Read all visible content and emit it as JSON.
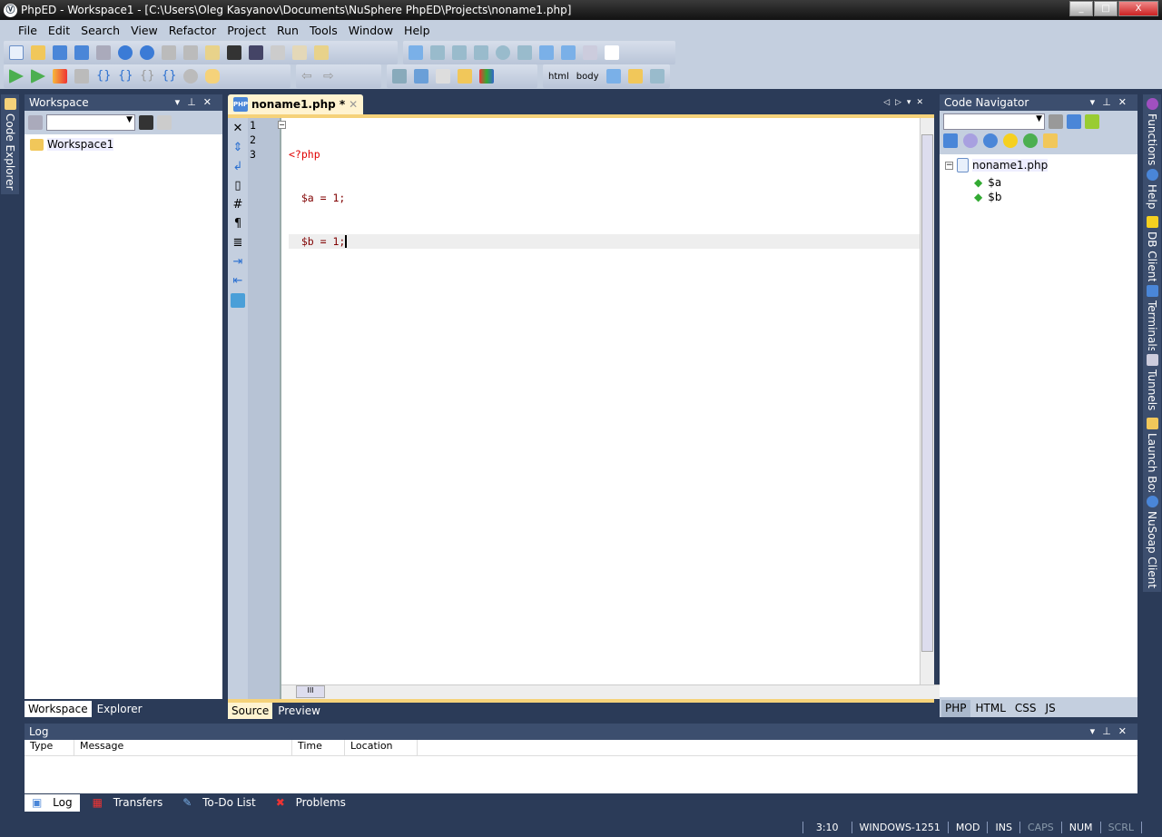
{
  "window": {
    "title": "PhpED - Workspace1 - [C:\\Users\\Oleg Kasyanov\\Documents\\NuSphere PhpED\\Projects\\noname1.php]",
    "min": "_",
    "max": "□",
    "close": "X"
  },
  "menu": [
    "File",
    "Edit",
    "Search",
    "View",
    "Refactor",
    "Project",
    "Run",
    "Tools",
    "Window",
    "Help"
  ],
  "toolbar": {
    "html_label": "html",
    "body_label": "body"
  },
  "left_strip": {
    "code_explorer": "Code Explorer"
  },
  "workspace": {
    "title": "Workspace",
    "tree_root": "Workspace1",
    "tabs": [
      "Workspace",
      "Explorer"
    ],
    "combo_value": ""
  },
  "editor": {
    "tab_label": "noname1.php *",
    "line_numbers": [
      "1",
      "2",
      "3"
    ],
    "lines": [
      "<?php",
      "  $a = 1;",
      "  $b = 1;"
    ],
    "bottom_tabs": [
      "Source",
      "Preview"
    ],
    "hscroll_grip": "III"
  },
  "navigator": {
    "title": "Code Navigator",
    "file": "noname1.php",
    "vars": [
      "$a",
      "$b"
    ],
    "tabs": [
      "PHP",
      "HTML",
      "CSS",
      "JS"
    ]
  },
  "right_strip": [
    "Functions",
    "Help",
    "DB Client",
    "Terminals",
    "Tunnels",
    "Launch Box",
    "NuSoap Client"
  ],
  "log": {
    "title": "Log",
    "columns": [
      "Type",
      "Message",
      "Time",
      "Location"
    ],
    "tabs": [
      "Log",
      "Transfers",
      "To-Do List",
      "Problems"
    ]
  },
  "status": {
    "position": "3:10",
    "encoding": "WINDOWS-1251",
    "mod": "MOD",
    "ins": "INS",
    "caps": "CAPS",
    "num": "NUM",
    "scrl": "SCRL"
  },
  "colors": {
    "accent": "#f5d27a",
    "php_tag": "#e00000",
    "variable": "#800000",
    "number": "#008080"
  }
}
